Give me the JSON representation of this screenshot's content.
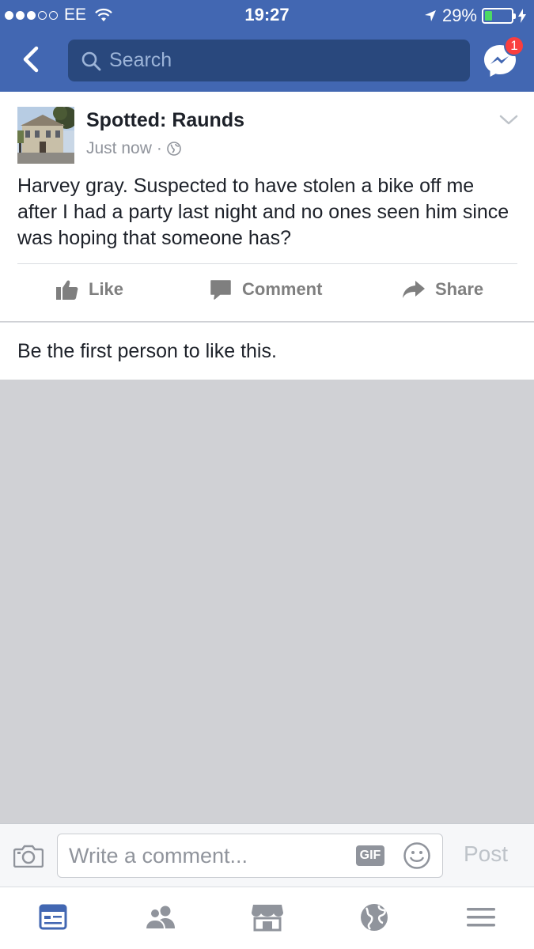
{
  "status_bar": {
    "carrier": "EE",
    "time": "19:27",
    "battery": "29%",
    "battery_level": 0.29
  },
  "header": {
    "search_placeholder": "Search",
    "messenger_badge": "1"
  },
  "post": {
    "page_name": "Spotted: Raunds",
    "timestamp": "Just now",
    "text": "Harvey gray. Suspected to have stolen a bike off me after I had a party last night and no ones seen him since was hoping that someone has?",
    "actions": {
      "like": "Like",
      "comment": "Comment",
      "share": "Share"
    }
  },
  "likes_summary": "Be the first person to like this.",
  "composer": {
    "placeholder": "Write a comment...",
    "gif_label": "GIF",
    "post_label": "Post"
  },
  "tabs": [
    "news-feed",
    "friends",
    "marketplace",
    "notifications",
    "menu"
  ],
  "colors": {
    "brand": "#4267b2",
    "search_bg": "#29487d",
    "badge": "#fa3e3e",
    "battery": "#4cd964",
    "active_tab": "#4267b2",
    "inactive_icon": "#90949c"
  }
}
